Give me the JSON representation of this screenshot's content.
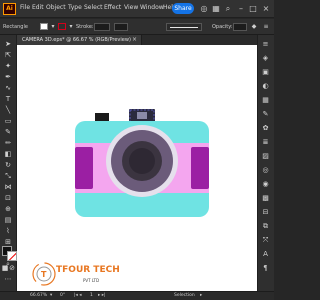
{
  "app": {
    "logo": "Ai"
  },
  "menu": {
    "items": [
      "File",
      "Edit",
      "Object",
      "Type",
      "Select",
      "Effect",
      "View",
      "Window",
      "Help"
    ]
  },
  "top_right": {
    "share_label": "Share"
  },
  "control_bar": {
    "selection_label": "Rectangle",
    "stroke_label": "Stroke:",
    "opacity_label": "Opacity:",
    "fill_color": "#ffffff",
    "stroke_color": "#d0021b"
  },
  "document": {
    "tab_title": "CAMERA 3D.eps* @ 66.67 % (RGB/Preview)",
    "close_glyph": "×"
  },
  "status": {
    "zoom": "66.67%",
    "mode": "Selection"
  },
  "watermark": {
    "brand": "TFOUR TECH",
    "sub": "PVT LTD"
  },
  "artwork_colors": {
    "body": "#6fe3e3",
    "band": "#f4a6ef",
    "side_panel": "#9b1fa3",
    "lens_ring_outer": "#e5e0ec",
    "lens_ring_mid": "#6b5b7a",
    "lens_ring_inner": "#3b3440",
    "shutter": "#1b1b1b",
    "flash": "#2b2b3d"
  }
}
